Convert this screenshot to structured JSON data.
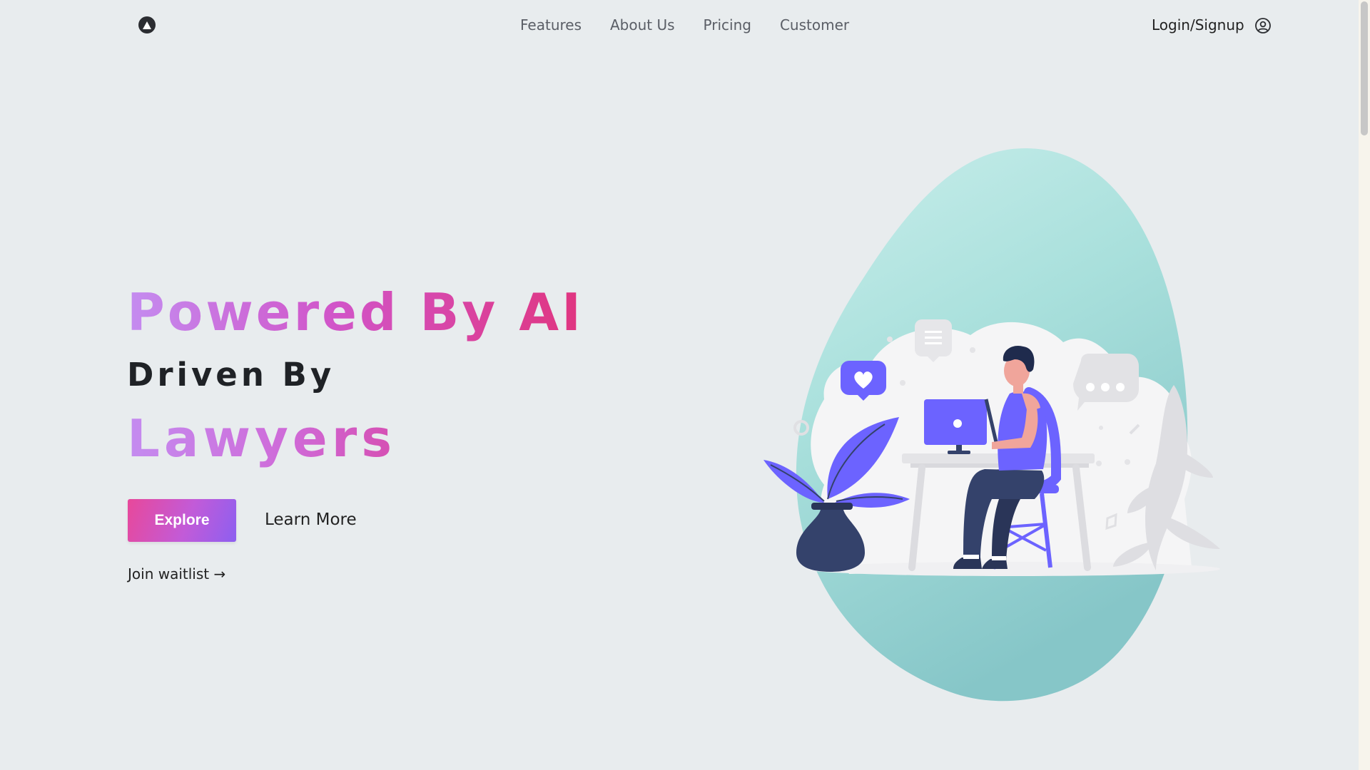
{
  "header": {
    "logo_icon": "triangle-logo-icon",
    "nav": [
      {
        "label": "Features"
      },
      {
        "label": "About Us"
      },
      {
        "label": "Pricing"
      },
      {
        "label": "Customer"
      }
    ],
    "login_label": "Login/Signup",
    "user_icon": "user-circle-icon"
  },
  "hero": {
    "line1": "Powered By AI",
    "line2": "Driven By",
    "line3": "Lawyers",
    "explore_label": "Explore",
    "learn_more_label": "Learn More",
    "waitlist_label": "Join waitlist →"
  },
  "illustration": {
    "subject": "person-at-laptop-illustration",
    "blob_color": "#8fd3cf",
    "accent_color": "#6c63ff",
    "pot_color": "#34426b"
  },
  "colors": {
    "background": "#e8ecee",
    "gradient_pink": "#e0357f",
    "gradient_violet": "#c48cf0"
  }
}
